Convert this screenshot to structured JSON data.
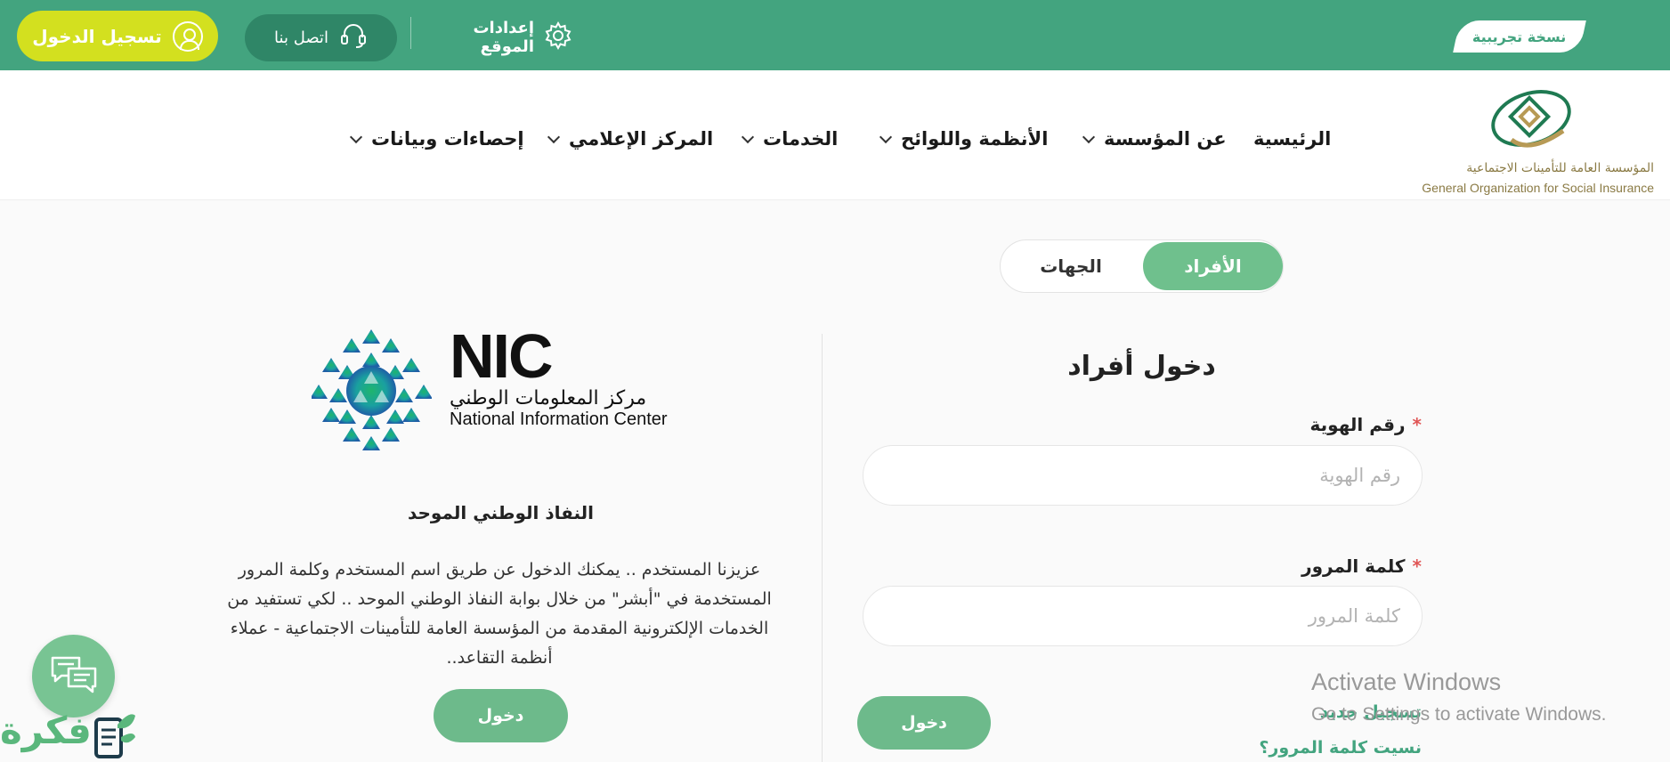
{
  "topbar": {
    "login_label": "تسجيل الدخول",
    "contact_label": "اتصل بنا",
    "settings_label": "إعدادات الموقع",
    "beta_label": "نسخة تجريبية"
  },
  "header": {
    "logo_ar": "المؤسسة العامة للتأمينات الاجتماعية",
    "logo_en": "General Organization for Social Insurance",
    "nav": [
      {
        "label": "الرئيسية"
      },
      {
        "label": "عن المؤسسة"
      },
      {
        "label": "الأنظمة واللوائح"
      },
      {
        "label": "الخدمات"
      },
      {
        "label": "المركز الإعلامي"
      },
      {
        "label": "إحصاءات وبيانات"
      }
    ]
  },
  "tabs": {
    "active": "الأفراد",
    "inactive": "الجهات"
  },
  "login_form": {
    "title": "دخول أفراد",
    "id_label": "رقم الهوية",
    "id_placeholder": "رقم الهوية",
    "password_label": "كلمة المرور",
    "password_placeholder": "كلمة المرور",
    "required_mark": "*",
    "submit_label": "دخول",
    "register_link": "تسجيل جديد",
    "forgot_link": "نسيت كلمة المرور؟"
  },
  "nafath": {
    "nic_wordmark": "NIC",
    "nic_ar": "مركز المعلومات الوطني",
    "nic_en": "National Information Center",
    "title": "النفاذ الوطني الموحد",
    "description": "عزيزنا المستخدم .. يمكنك الدخول عن طريق اسم المستخدم وكلمة المرور المستخدمة في \"أبشر\" من خلال بوابة النفاذ الوطني الموحد .. لكي تستفيد من الخدمات الإلكترونية المقدمة من المؤسسة العامة للتأمينات الاجتماعية - عملاء أنظمة التقاعد..",
    "button_label": "دخول"
  },
  "os_watermark": {
    "title": "Activate Windows",
    "subtitle": "Go to Settings to activate Windows."
  },
  "brand_watermark": "فكرة",
  "colors": {
    "primary_green": "#43a47f",
    "dark_green": "#2f8667",
    "lime": "#d3e01f",
    "button_green": "#6dba8b"
  },
  "icons": [
    "user-icon",
    "headset-icon",
    "gear-icon",
    "chevron-down-icon",
    "chat-icon"
  ]
}
